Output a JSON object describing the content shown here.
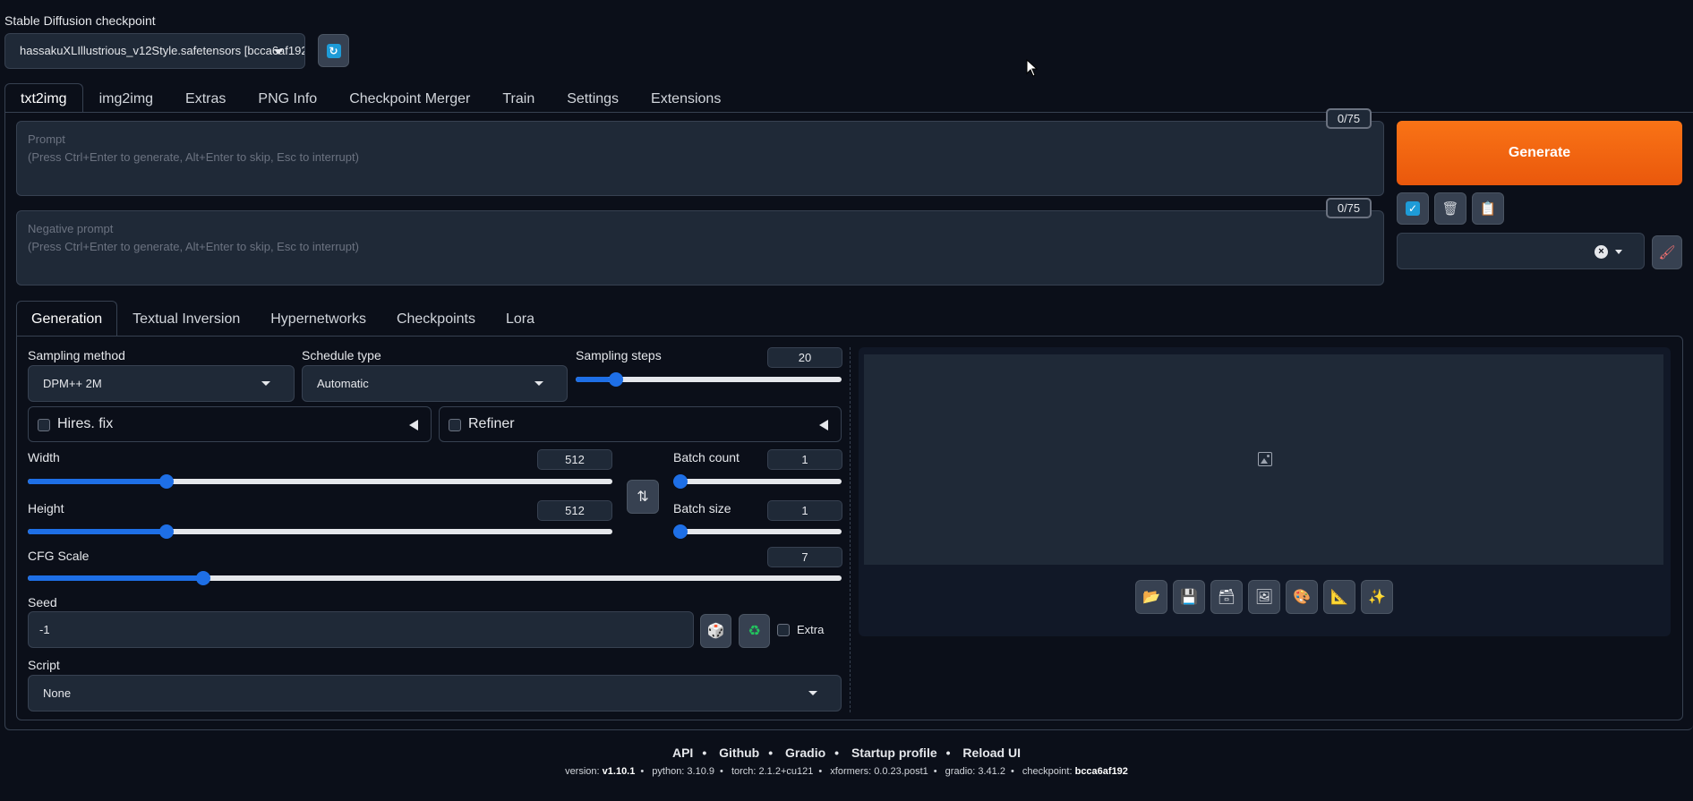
{
  "checkpoint": {
    "label": "Stable Diffusion checkpoint",
    "value": "hassakuXLIllustrious_v12Style.safetensors [bcca6af192]"
  },
  "main_tabs": [
    "txt2img",
    "img2img",
    "Extras",
    "PNG Info",
    "Checkpoint Merger",
    "Train",
    "Settings",
    "Extensions"
  ],
  "prompt": {
    "placeholder_title": "Prompt",
    "placeholder_hint": "(Press Ctrl+Enter to generate, Alt+Enter to skip, Esc to interrupt)",
    "token_count": "0/75"
  },
  "negative_prompt": {
    "placeholder_title": "Negative prompt",
    "placeholder_hint": "(Press Ctrl+Enter to generate, Alt+Enter to skip, Esc to interrupt)",
    "token_count": "0/75"
  },
  "generate_label": "Generate",
  "sub_tabs": [
    "Generation",
    "Textual Inversion",
    "Hypernetworks",
    "Checkpoints",
    "Lora"
  ],
  "generation": {
    "sampling_method": {
      "label": "Sampling method",
      "value": "DPM++ 2M"
    },
    "schedule_type": {
      "label": "Schedule type",
      "value": "Automatic"
    },
    "sampling_steps": {
      "label": "Sampling steps",
      "value": "20",
      "fraction": 0.13
    },
    "hires_fix": "Hires. fix",
    "refiner": "Refiner",
    "width": {
      "label": "Width",
      "value": "512",
      "fraction": 0.23
    },
    "height": {
      "label": "Height",
      "value": "512",
      "fraction": 0.23
    },
    "batch_count": {
      "label": "Batch count",
      "value": "1",
      "fraction": 0
    },
    "batch_size": {
      "label": "Batch size",
      "value": "1",
      "fraction": 0
    },
    "cfg_scale": {
      "label": "CFG Scale",
      "value": "7",
      "fraction": 0.21
    },
    "seed": {
      "label": "Seed",
      "value": "-1"
    },
    "extra_label": "Extra",
    "script": {
      "label": "Script",
      "value": "None"
    }
  },
  "footer": {
    "links": [
      "API",
      "Github",
      "Gradio",
      "Startup profile",
      "Reload UI"
    ],
    "version_label": "version:",
    "version": "v1.10.1",
    "python": "python: 3.10.9",
    "torch": "torch: 2.1.2+cu121",
    "xformers": "xformers: 0.0.23.post1",
    "gradio": "gradio: 3.41.2",
    "checkpoint_label": "checkpoint:",
    "checkpoint": "bcca6af192"
  },
  "colors": {
    "background": "#0b0f19",
    "generate": "#f97316",
    "slider": "#1e6fe6"
  },
  "icons": {
    "tool_buttons": [
      "folder-icon",
      "save-icon",
      "zip-icon",
      "image-send-icon",
      "palette-icon",
      "ruler-icon",
      "sparkle-icon"
    ]
  }
}
